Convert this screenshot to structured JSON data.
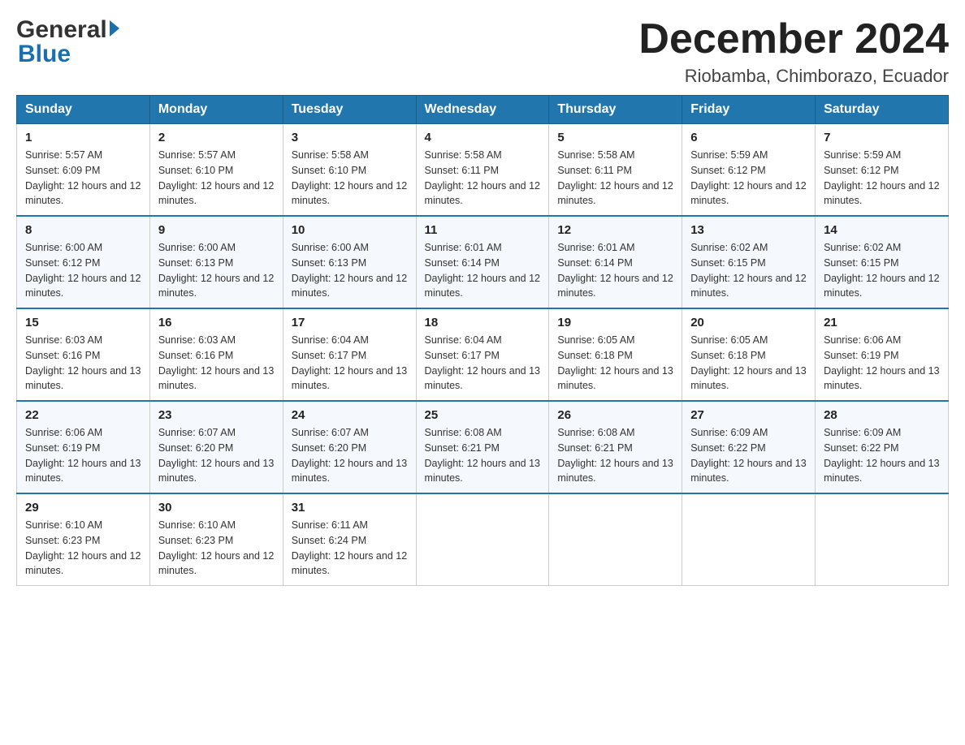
{
  "header": {
    "logo_general": "General",
    "logo_blue": "Blue",
    "month_title": "December 2024",
    "location": "Riobamba, Chimborazo, Ecuador"
  },
  "weekdays": [
    "Sunday",
    "Monday",
    "Tuesday",
    "Wednesday",
    "Thursday",
    "Friday",
    "Saturday"
  ],
  "weeks": [
    [
      {
        "day": "1",
        "sunrise": "5:57 AM",
        "sunset": "6:09 PM",
        "daylight": "12 hours and 12 minutes."
      },
      {
        "day": "2",
        "sunrise": "5:57 AM",
        "sunset": "6:10 PM",
        "daylight": "12 hours and 12 minutes."
      },
      {
        "day": "3",
        "sunrise": "5:58 AM",
        "sunset": "6:10 PM",
        "daylight": "12 hours and 12 minutes."
      },
      {
        "day": "4",
        "sunrise": "5:58 AM",
        "sunset": "6:11 PM",
        "daylight": "12 hours and 12 minutes."
      },
      {
        "day": "5",
        "sunrise": "5:58 AM",
        "sunset": "6:11 PM",
        "daylight": "12 hours and 12 minutes."
      },
      {
        "day": "6",
        "sunrise": "5:59 AM",
        "sunset": "6:12 PM",
        "daylight": "12 hours and 12 minutes."
      },
      {
        "day": "7",
        "sunrise": "5:59 AM",
        "sunset": "6:12 PM",
        "daylight": "12 hours and 12 minutes."
      }
    ],
    [
      {
        "day": "8",
        "sunrise": "6:00 AM",
        "sunset": "6:12 PM",
        "daylight": "12 hours and 12 minutes."
      },
      {
        "day": "9",
        "sunrise": "6:00 AM",
        "sunset": "6:13 PM",
        "daylight": "12 hours and 12 minutes."
      },
      {
        "day": "10",
        "sunrise": "6:00 AM",
        "sunset": "6:13 PM",
        "daylight": "12 hours and 12 minutes."
      },
      {
        "day": "11",
        "sunrise": "6:01 AM",
        "sunset": "6:14 PM",
        "daylight": "12 hours and 12 minutes."
      },
      {
        "day": "12",
        "sunrise": "6:01 AM",
        "sunset": "6:14 PM",
        "daylight": "12 hours and 12 minutes."
      },
      {
        "day": "13",
        "sunrise": "6:02 AM",
        "sunset": "6:15 PM",
        "daylight": "12 hours and 12 minutes."
      },
      {
        "day": "14",
        "sunrise": "6:02 AM",
        "sunset": "6:15 PM",
        "daylight": "12 hours and 12 minutes."
      }
    ],
    [
      {
        "day": "15",
        "sunrise": "6:03 AM",
        "sunset": "6:16 PM",
        "daylight": "12 hours and 13 minutes."
      },
      {
        "day": "16",
        "sunrise": "6:03 AM",
        "sunset": "6:16 PM",
        "daylight": "12 hours and 13 minutes."
      },
      {
        "day": "17",
        "sunrise": "6:04 AM",
        "sunset": "6:17 PM",
        "daylight": "12 hours and 13 minutes."
      },
      {
        "day": "18",
        "sunrise": "6:04 AM",
        "sunset": "6:17 PM",
        "daylight": "12 hours and 13 minutes."
      },
      {
        "day": "19",
        "sunrise": "6:05 AM",
        "sunset": "6:18 PM",
        "daylight": "12 hours and 13 minutes."
      },
      {
        "day": "20",
        "sunrise": "6:05 AM",
        "sunset": "6:18 PM",
        "daylight": "12 hours and 13 minutes."
      },
      {
        "day": "21",
        "sunrise": "6:06 AM",
        "sunset": "6:19 PM",
        "daylight": "12 hours and 13 minutes."
      }
    ],
    [
      {
        "day": "22",
        "sunrise": "6:06 AM",
        "sunset": "6:19 PM",
        "daylight": "12 hours and 13 minutes."
      },
      {
        "day": "23",
        "sunrise": "6:07 AM",
        "sunset": "6:20 PM",
        "daylight": "12 hours and 13 minutes."
      },
      {
        "day": "24",
        "sunrise": "6:07 AM",
        "sunset": "6:20 PM",
        "daylight": "12 hours and 13 minutes."
      },
      {
        "day": "25",
        "sunrise": "6:08 AM",
        "sunset": "6:21 PM",
        "daylight": "12 hours and 13 minutes."
      },
      {
        "day": "26",
        "sunrise": "6:08 AM",
        "sunset": "6:21 PM",
        "daylight": "12 hours and 13 minutes."
      },
      {
        "day": "27",
        "sunrise": "6:09 AM",
        "sunset": "6:22 PM",
        "daylight": "12 hours and 13 minutes."
      },
      {
        "day": "28",
        "sunrise": "6:09 AM",
        "sunset": "6:22 PM",
        "daylight": "12 hours and 13 minutes."
      }
    ],
    [
      {
        "day": "29",
        "sunrise": "6:10 AM",
        "sunset": "6:23 PM",
        "daylight": "12 hours and 12 minutes."
      },
      {
        "day": "30",
        "sunrise": "6:10 AM",
        "sunset": "6:23 PM",
        "daylight": "12 hours and 12 minutes."
      },
      {
        "day": "31",
        "sunrise": "6:11 AM",
        "sunset": "6:24 PM",
        "daylight": "12 hours and 12 minutes."
      },
      null,
      null,
      null,
      null
    ]
  ],
  "labels": {
    "sunrise_prefix": "Sunrise: ",
    "sunset_prefix": "Sunset: ",
    "daylight_prefix": "Daylight: "
  }
}
